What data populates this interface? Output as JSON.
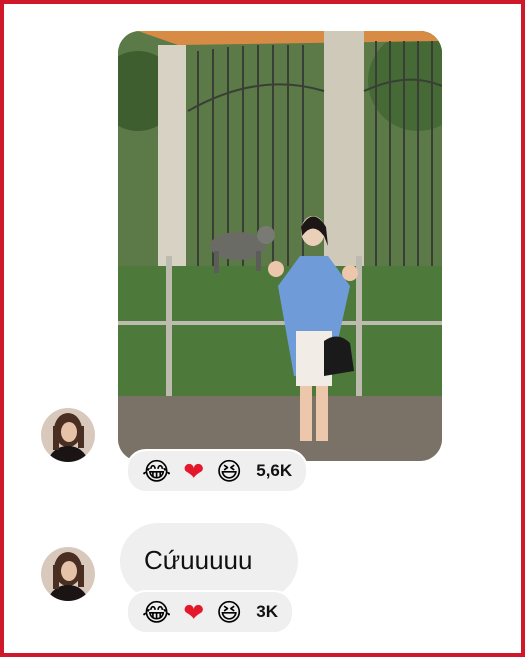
{
  "colors": {
    "frame_border": "#d0182b",
    "bubble_bg": "#efeff0",
    "heart": "#e3192b"
  },
  "messages": [
    {
      "type": "photo",
      "avatar": "sender-avatar",
      "reactions": {
        "icons": [
          "laughing-tears-emoji",
          "red-heart-emoji",
          "grinning-squint-emoji"
        ],
        "emoji": [
          "😂",
          "❤",
          "😆"
        ],
        "count": "5,6K"
      }
    },
    {
      "type": "text",
      "avatar": "sender-avatar",
      "text": "Cứuuuuu",
      "reactions": {
        "icons": [
          "laughing-tears-emoji",
          "red-heart-emoji",
          "grinning-squint-emoji"
        ],
        "emoji": [
          "😂",
          "❤",
          "😆"
        ],
        "count": "3K"
      }
    }
  ]
}
